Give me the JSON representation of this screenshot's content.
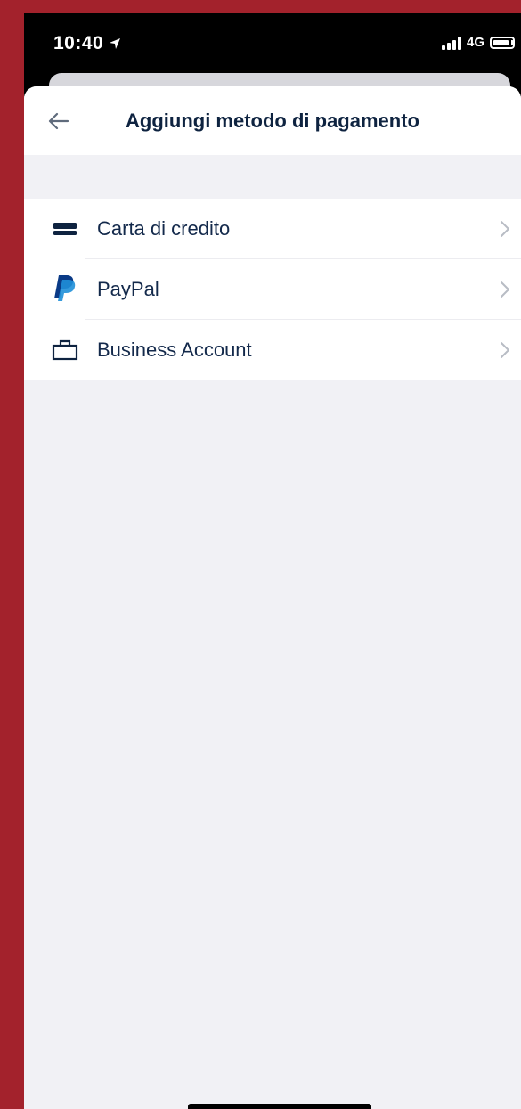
{
  "status_bar": {
    "time": "10:40",
    "network": "4G"
  },
  "header": {
    "title": "Aggiungi metodo di pagamento"
  },
  "payment_methods": [
    {
      "label": "Carta di credito",
      "icon": "credit-card-icon"
    },
    {
      "label": "PayPal",
      "icon": "paypal-logo-icon"
    },
    {
      "label": "Business Account",
      "icon": "briefcase-icon"
    }
  ],
  "colors": {
    "accent_frame": "#a3222c",
    "text_primary": "#13294b",
    "background": "#f1f1f5"
  }
}
